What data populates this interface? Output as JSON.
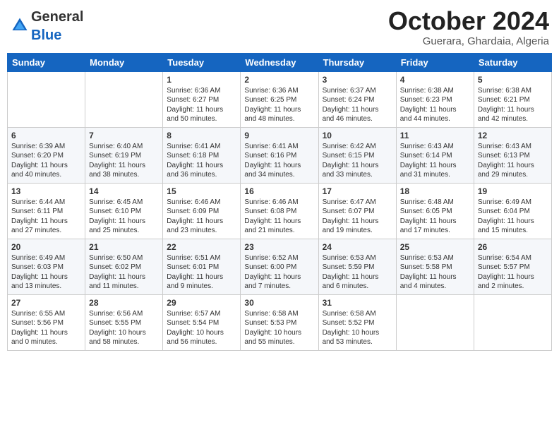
{
  "header": {
    "logo_general": "General",
    "logo_blue": "Blue",
    "month_title": "October 2024",
    "location": "Guerara, Ghardaia, Algeria"
  },
  "weekdays": [
    "Sunday",
    "Monday",
    "Tuesday",
    "Wednesday",
    "Thursday",
    "Friday",
    "Saturday"
  ],
  "weeks": [
    [
      {
        "day": "",
        "info": ""
      },
      {
        "day": "",
        "info": ""
      },
      {
        "day": "1",
        "info": "Sunrise: 6:36 AM\nSunset: 6:27 PM\nDaylight: 11 hours and 50 minutes."
      },
      {
        "day": "2",
        "info": "Sunrise: 6:36 AM\nSunset: 6:25 PM\nDaylight: 11 hours and 48 minutes."
      },
      {
        "day": "3",
        "info": "Sunrise: 6:37 AM\nSunset: 6:24 PM\nDaylight: 11 hours and 46 minutes."
      },
      {
        "day": "4",
        "info": "Sunrise: 6:38 AM\nSunset: 6:23 PM\nDaylight: 11 hours and 44 minutes."
      },
      {
        "day": "5",
        "info": "Sunrise: 6:38 AM\nSunset: 6:21 PM\nDaylight: 11 hours and 42 minutes."
      }
    ],
    [
      {
        "day": "6",
        "info": "Sunrise: 6:39 AM\nSunset: 6:20 PM\nDaylight: 11 hours and 40 minutes."
      },
      {
        "day": "7",
        "info": "Sunrise: 6:40 AM\nSunset: 6:19 PM\nDaylight: 11 hours and 38 minutes."
      },
      {
        "day": "8",
        "info": "Sunrise: 6:41 AM\nSunset: 6:18 PM\nDaylight: 11 hours and 36 minutes."
      },
      {
        "day": "9",
        "info": "Sunrise: 6:41 AM\nSunset: 6:16 PM\nDaylight: 11 hours and 34 minutes."
      },
      {
        "day": "10",
        "info": "Sunrise: 6:42 AM\nSunset: 6:15 PM\nDaylight: 11 hours and 33 minutes."
      },
      {
        "day": "11",
        "info": "Sunrise: 6:43 AM\nSunset: 6:14 PM\nDaylight: 11 hours and 31 minutes."
      },
      {
        "day": "12",
        "info": "Sunrise: 6:43 AM\nSunset: 6:13 PM\nDaylight: 11 hours and 29 minutes."
      }
    ],
    [
      {
        "day": "13",
        "info": "Sunrise: 6:44 AM\nSunset: 6:11 PM\nDaylight: 11 hours and 27 minutes."
      },
      {
        "day": "14",
        "info": "Sunrise: 6:45 AM\nSunset: 6:10 PM\nDaylight: 11 hours and 25 minutes."
      },
      {
        "day": "15",
        "info": "Sunrise: 6:46 AM\nSunset: 6:09 PM\nDaylight: 11 hours and 23 minutes."
      },
      {
        "day": "16",
        "info": "Sunrise: 6:46 AM\nSunset: 6:08 PM\nDaylight: 11 hours and 21 minutes."
      },
      {
        "day": "17",
        "info": "Sunrise: 6:47 AM\nSunset: 6:07 PM\nDaylight: 11 hours and 19 minutes."
      },
      {
        "day": "18",
        "info": "Sunrise: 6:48 AM\nSunset: 6:05 PM\nDaylight: 11 hours and 17 minutes."
      },
      {
        "day": "19",
        "info": "Sunrise: 6:49 AM\nSunset: 6:04 PM\nDaylight: 11 hours and 15 minutes."
      }
    ],
    [
      {
        "day": "20",
        "info": "Sunrise: 6:49 AM\nSunset: 6:03 PM\nDaylight: 11 hours and 13 minutes."
      },
      {
        "day": "21",
        "info": "Sunrise: 6:50 AM\nSunset: 6:02 PM\nDaylight: 11 hours and 11 minutes."
      },
      {
        "day": "22",
        "info": "Sunrise: 6:51 AM\nSunset: 6:01 PM\nDaylight: 11 hours and 9 minutes."
      },
      {
        "day": "23",
        "info": "Sunrise: 6:52 AM\nSunset: 6:00 PM\nDaylight: 11 hours and 7 minutes."
      },
      {
        "day": "24",
        "info": "Sunrise: 6:53 AM\nSunset: 5:59 PM\nDaylight: 11 hours and 6 minutes."
      },
      {
        "day": "25",
        "info": "Sunrise: 6:53 AM\nSunset: 5:58 PM\nDaylight: 11 hours and 4 minutes."
      },
      {
        "day": "26",
        "info": "Sunrise: 6:54 AM\nSunset: 5:57 PM\nDaylight: 11 hours and 2 minutes."
      }
    ],
    [
      {
        "day": "27",
        "info": "Sunrise: 6:55 AM\nSunset: 5:56 PM\nDaylight: 11 hours and 0 minutes."
      },
      {
        "day": "28",
        "info": "Sunrise: 6:56 AM\nSunset: 5:55 PM\nDaylight: 10 hours and 58 minutes."
      },
      {
        "day": "29",
        "info": "Sunrise: 6:57 AM\nSunset: 5:54 PM\nDaylight: 10 hours and 56 minutes."
      },
      {
        "day": "30",
        "info": "Sunrise: 6:58 AM\nSunset: 5:53 PM\nDaylight: 10 hours and 55 minutes."
      },
      {
        "day": "31",
        "info": "Sunrise: 6:58 AM\nSunset: 5:52 PM\nDaylight: 10 hours and 53 minutes."
      },
      {
        "day": "",
        "info": ""
      },
      {
        "day": "",
        "info": ""
      }
    ]
  ]
}
